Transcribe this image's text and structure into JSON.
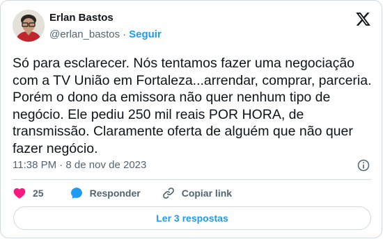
{
  "author": {
    "name": "Erlan Bastos",
    "handle": "@erlan_bastos",
    "separator": "·",
    "follow_label": "Seguir"
  },
  "tweet": {
    "lines": [
      "Só para esclarecer. Nós tentamos fazer uma negociação",
      "com a TV União em Fortaleza...arrendar, comprar, parceria.",
      "Porém o dono da emissora não quer nenhum tipo de",
      "negócio. Ele pediu 250 mil reais POR HORA, de",
      "transmissão. Claramente oferta de alguém que não quer",
      "fazer negócio."
    ],
    "timestamp": "11:38 PM · 8 de nov de 2023"
  },
  "actions": {
    "like_count": "25",
    "reply_label": "Responder",
    "copy_link_label": "Copiar link"
  },
  "replies_button": "Ler 3 respostas",
  "icons": {
    "brand": "x-logo-icon",
    "info": "info-icon",
    "like": "heart-icon",
    "reply": "speech-bubble-icon",
    "copy": "link-icon"
  },
  "colors": {
    "accent": "#1d9bf0",
    "like": "#f91880",
    "text": "#0f1419",
    "secondary": "#536471",
    "border": "#cfd9de"
  }
}
